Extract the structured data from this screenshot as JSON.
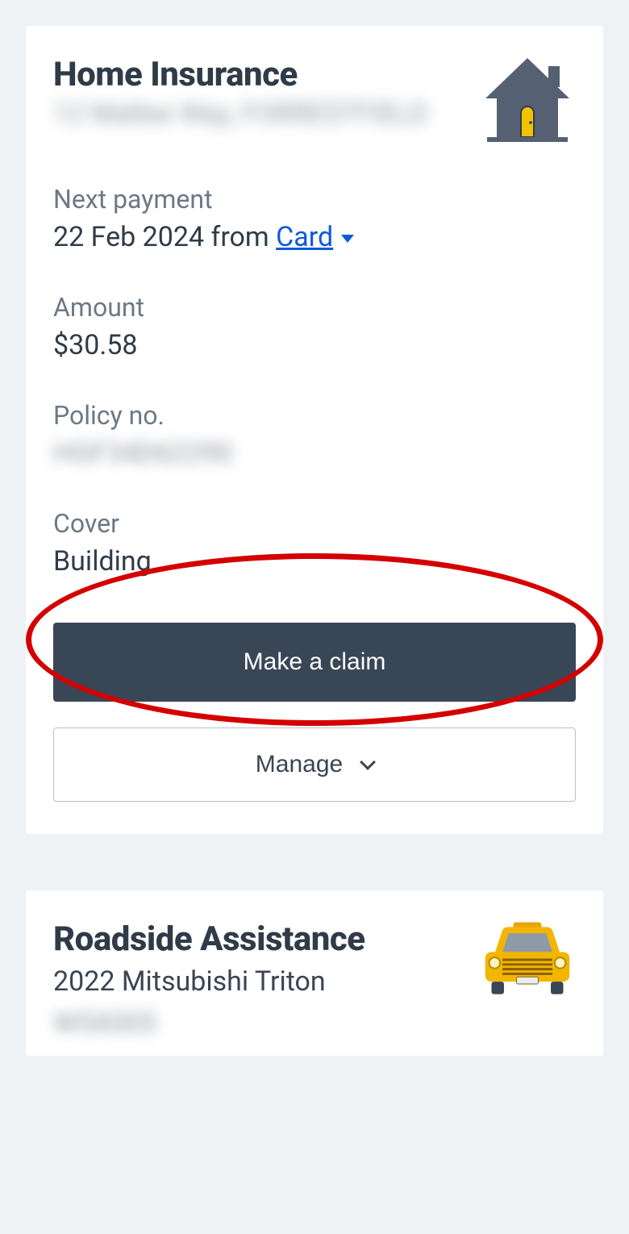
{
  "home": {
    "title": "Home Insurance",
    "address_redacted": "12 Mallee Way, FORRESTFIELD",
    "next_payment_label": "Next payment",
    "next_payment_date": "22 Feb 2024 from ",
    "payment_source": "Card",
    "amount_label": "Amount",
    "amount_value": "$30.58",
    "policy_label": "Policy no.",
    "policy_value_redacted": "HGF34D62290",
    "cover_label": "Cover",
    "cover_value": "Building",
    "make_claim_label": "Make a claim",
    "manage_label": "Manage"
  },
  "roadside": {
    "title": "Roadside Assistance",
    "vehicle": "2022 Mitsubishi Triton",
    "reg_redacted": "W5X005"
  }
}
